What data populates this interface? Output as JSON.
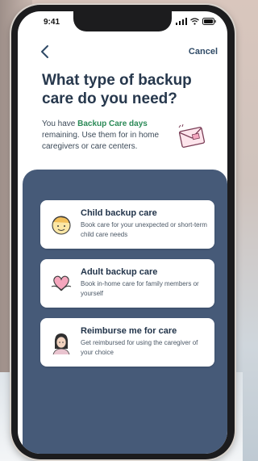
{
  "status": {
    "time": "9:41"
  },
  "nav": {
    "cancel_label": "Cancel"
  },
  "page": {
    "title": "What type of backup care do you need?",
    "desc_prefix": "You have ",
    "desc_highlight": "Backup Care days",
    "desc_suffix": " remaining. Use them for in home caregivers or care centers."
  },
  "options": [
    {
      "title": "Child backup care",
      "subtitle": "Book care for your unexpected or short-term child care needs",
      "icon": "child-face-icon"
    },
    {
      "title": "Adult backup care",
      "subtitle": "Book in-home care for family members or yourself",
      "icon": "heart-hands-icon"
    },
    {
      "title": "Reimburse me for care",
      "subtitle": "Get reimbursed for using the caregiver of your choice",
      "icon": "caregiver-avatar-icon"
    }
  ],
  "colors": {
    "panel": "#465a78",
    "highlight": "#2b8a57",
    "title": "#27384d"
  }
}
